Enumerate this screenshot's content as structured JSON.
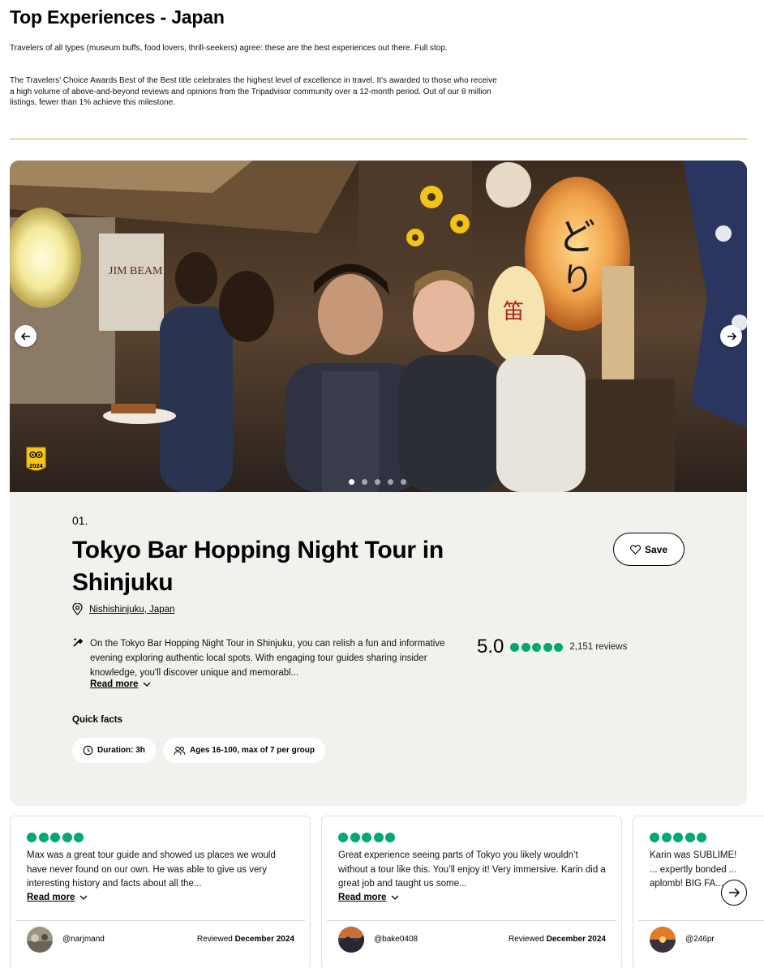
{
  "page": {
    "title": "Top Experiences - Japan",
    "intro_1": "Travelers of all types (museum buffs, food lovers, thrill-seekers) agree: these are the best experiences out there. Full stop.",
    "intro_2": "The Travelers’ Choice Awards Best of the Best title celebrates the highest level of excellence in travel. It’s awarded to those who receive a high volume of above-and-beyond reviews and opinions from the Tripadvisor community over a 12-month period. Out of our 8 million listings, fewer than 1% achieve this milestone.",
    "accent_color": "#c8a93a"
  },
  "hero": {
    "badge_year": "2024",
    "slide_count": 5,
    "active_slide": 1,
    "prev_icon": "arrow-left-icon",
    "next_icon": "arrow-right-icon"
  },
  "listing": {
    "rank": "01.",
    "title": "Tokyo Bar Hopping Night Tour in Shinjuku",
    "save_label": "Save",
    "location": "Nishishinjuku, Japan",
    "description": "On the Tokyo Bar Hopping Night Tour in Shinjuku, you can relish a fun and informative evening exploring authentic local spots. With engaging tour guides sharing insider knowledge, you'll discover unique and memorabl...",
    "read_more": "Read more",
    "score": "5.0",
    "bubbles": 5,
    "reviews_count": "2,151 reviews",
    "quick_facts_title": "Quick facts",
    "facts": [
      {
        "icon": "clock-icon",
        "label": "Duration: 3h"
      },
      {
        "icon": "group-icon",
        "label": "Ages 16-100, max of 7 per group"
      }
    ],
    "rating_color": "#00aa6c"
  },
  "reviews": [
    {
      "bubbles": 5,
      "text": "Max was a great tour guide and showed us places we would have never found on our own. He was able to give us very interesting history and facts about all the...",
      "read_more": "Read more",
      "handle": "@narjmand",
      "reviewed_label": "Reviewed",
      "date": "December 2024"
    },
    {
      "bubbles": 5,
      "text": "Great experience seeing parts of Tokyo you likely wouldn’t without a tour like this. You’ll enjoy it! Very immersive. Karin did a great job and taught us some...",
      "read_more": "Read more",
      "handle": "@bake0408",
      "reviewed_label": "Reviewed",
      "date": "December 2024"
    },
    {
      "bubbles": 5,
      "text": "Karin was SUBLIME! ... expertly bonded ... aplomb! BIG FA...",
      "handle": "@246pr"
    }
  ]
}
